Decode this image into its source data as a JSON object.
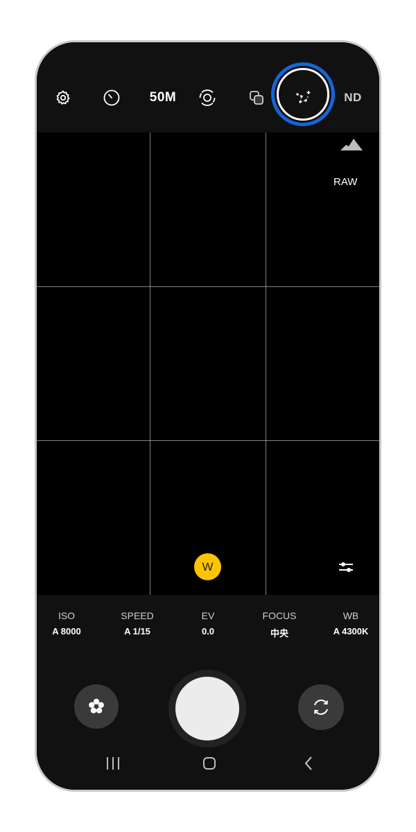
{
  "toolbar": {
    "resolution_label": "50M",
    "nd_label": "ND",
    "icons": [
      "settings-icon",
      "timer-icon",
      "resolution",
      "metering-icon",
      "overlay-icon",
      "star-trail-icon",
      "nd-filter"
    ]
  },
  "viewfinder": {
    "raw_label": "RAW",
    "lens_label": "W",
    "histogram_icon": "histogram-icon",
    "adjust_icon": "sliders-icon"
  },
  "pro_settings": [
    {
      "label": "ISO",
      "value": "A 8000"
    },
    {
      "label": "SPEED",
      "value": "A 1/15"
    },
    {
      "label": "EV",
      "value": "0.0"
    },
    {
      "label": "FOCUS",
      "value": "中央"
    },
    {
      "label": "WB",
      "value": "A 4300K"
    }
  ],
  "controls": {
    "left_icon": "flower-icon",
    "shutter": "shutter-button",
    "right_icon": "switch-camera-icon"
  },
  "navbar": [
    "recent-apps-icon",
    "home-icon",
    "back-icon"
  ],
  "colors": {
    "highlight_ring": "#1565d8",
    "lens_badge": "#ffc400"
  }
}
